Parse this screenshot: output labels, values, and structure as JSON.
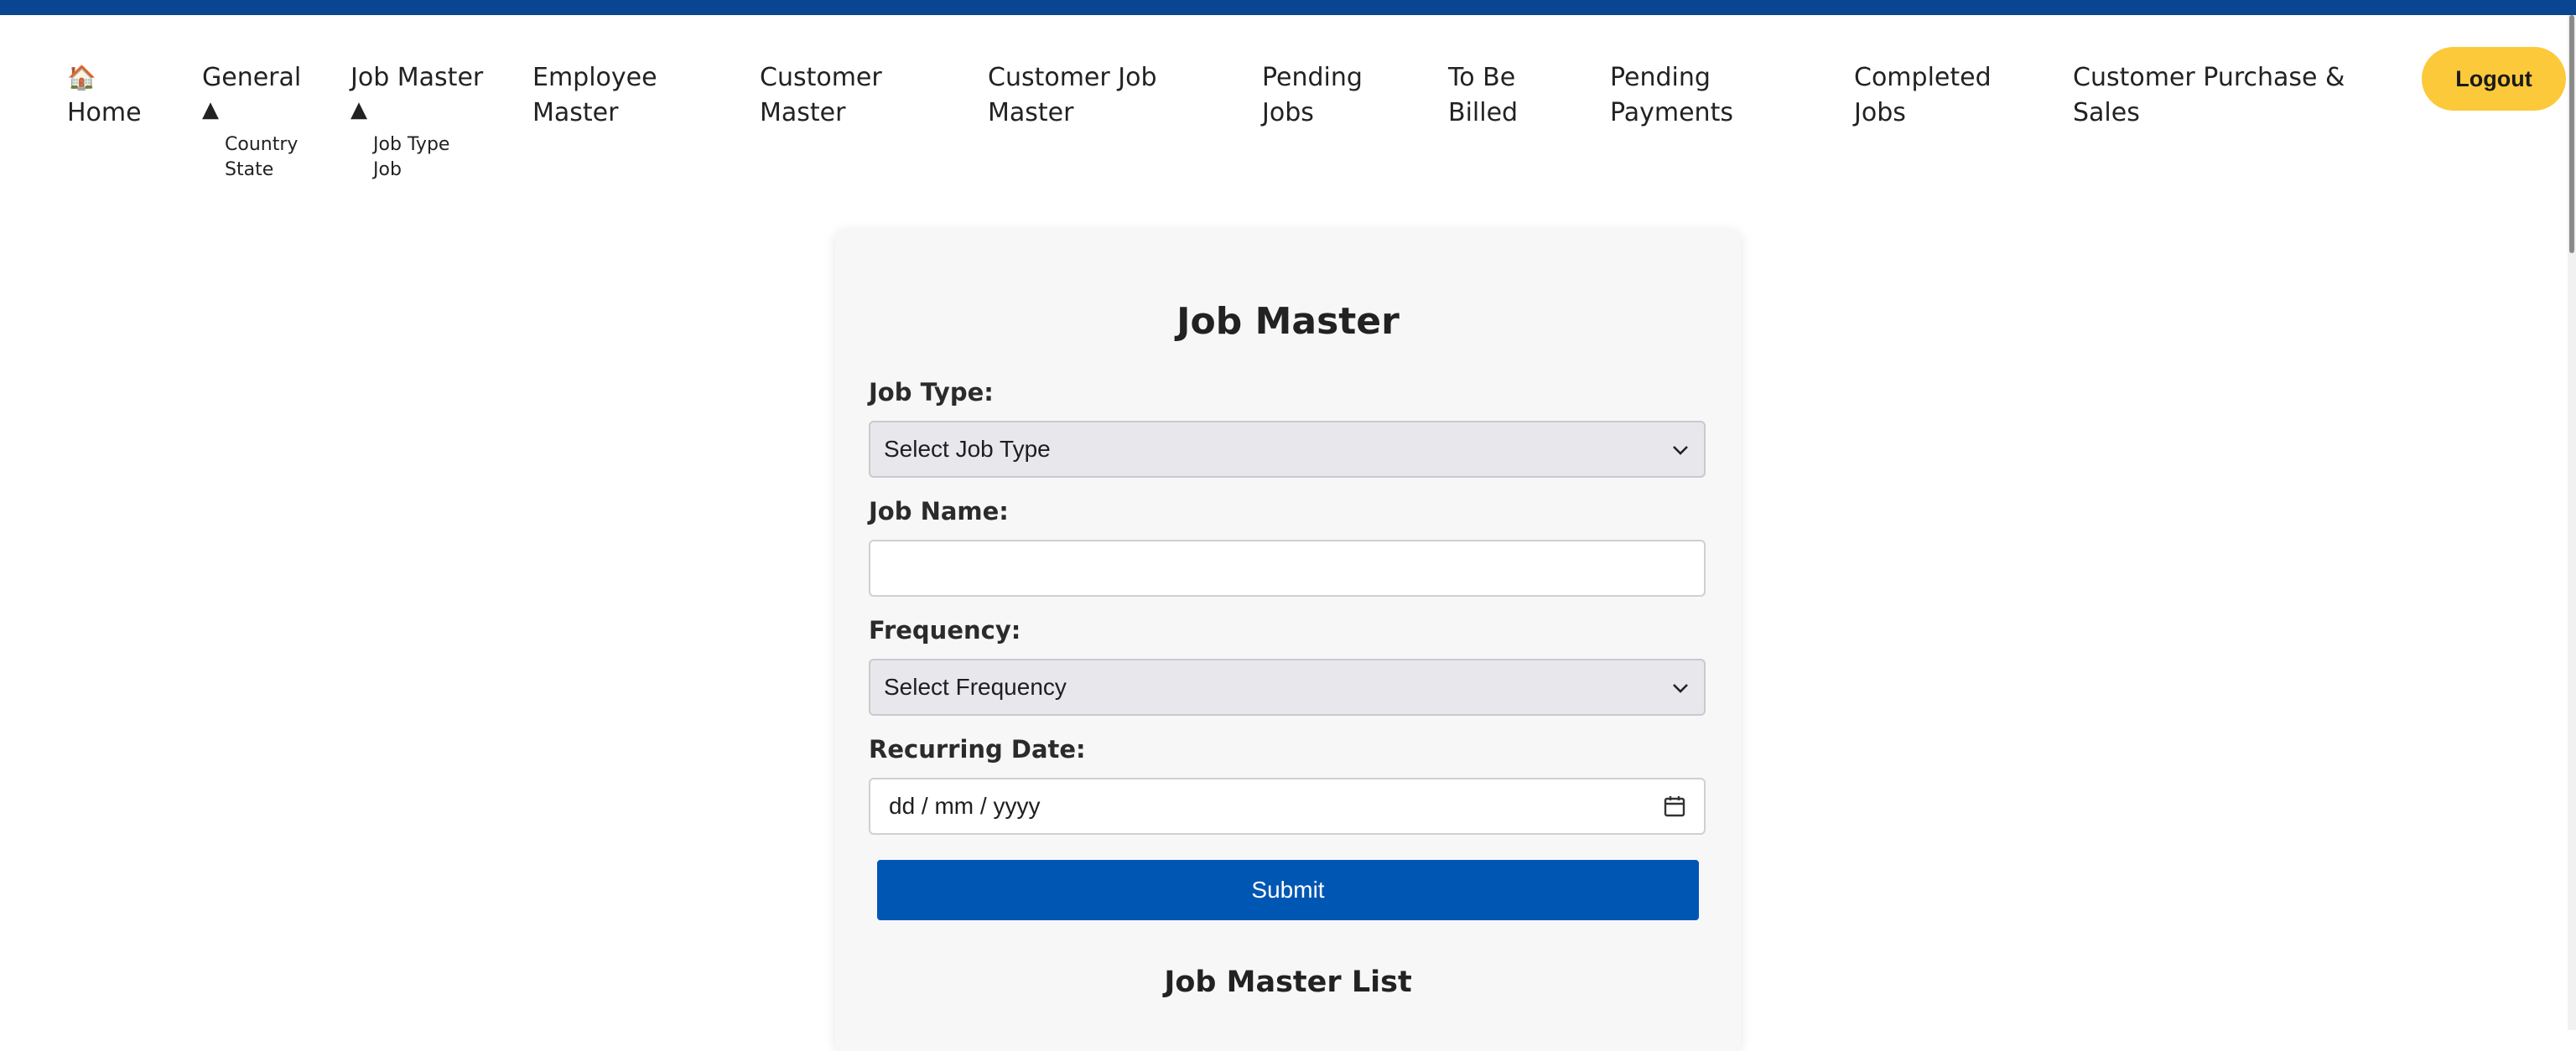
{
  "nav": {
    "home": {
      "icon": "home-icon",
      "label": "Home"
    },
    "general": {
      "label": "General",
      "caret": "▲",
      "submenu": [
        "Country",
        "State"
      ]
    },
    "job_master": {
      "label": "Job Master",
      "caret": "▲",
      "submenu": [
        "Job Type",
        "Job"
      ]
    },
    "employee_master": [
      "Employee",
      "Master"
    ],
    "customer_master": [
      "Customer",
      "Master"
    ],
    "customer_job_master": [
      "Customer Job",
      "Master"
    ],
    "pending_jobs": [
      "Pending",
      "Jobs"
    ],
    "to_be_billed": [
      "To Be",
      "Billed"
    ],
    "pending_payments": [
      "Pending",
      "Payments"
    ],
    "completed_jobs": [
      "Completed",
      "Jobs"
    ],
    "customer_purchase_sales": [
      "Customer Purchase &",
      "Sales"
    ],
    "logout_label": "Logout"
  },
  "form": {
    "title": "Job Master",
    "job_type": {
      "label": "Job Type:",
      "selected": "Select Job Type"
    },
    "job_name": {
      "label": "Job Name:",
      "value": ""
    },
    "frequency": {
      "label": "Frequency:",
      "selected": "Select Frequency"
    },
    "recurring_date": {
      "label": "Recurring Date:",
      "placeholder": "dd / mm / yyyy"
    },
    "submit_label": "Submit"
  },
  "list": {
    "title": "Job Master List"
  },
  "colors": {
    "topbar": "#0a4592",
    "logout_bg": "#fcc93a",
    "submit_bg": "#0056b3"
  }
}
